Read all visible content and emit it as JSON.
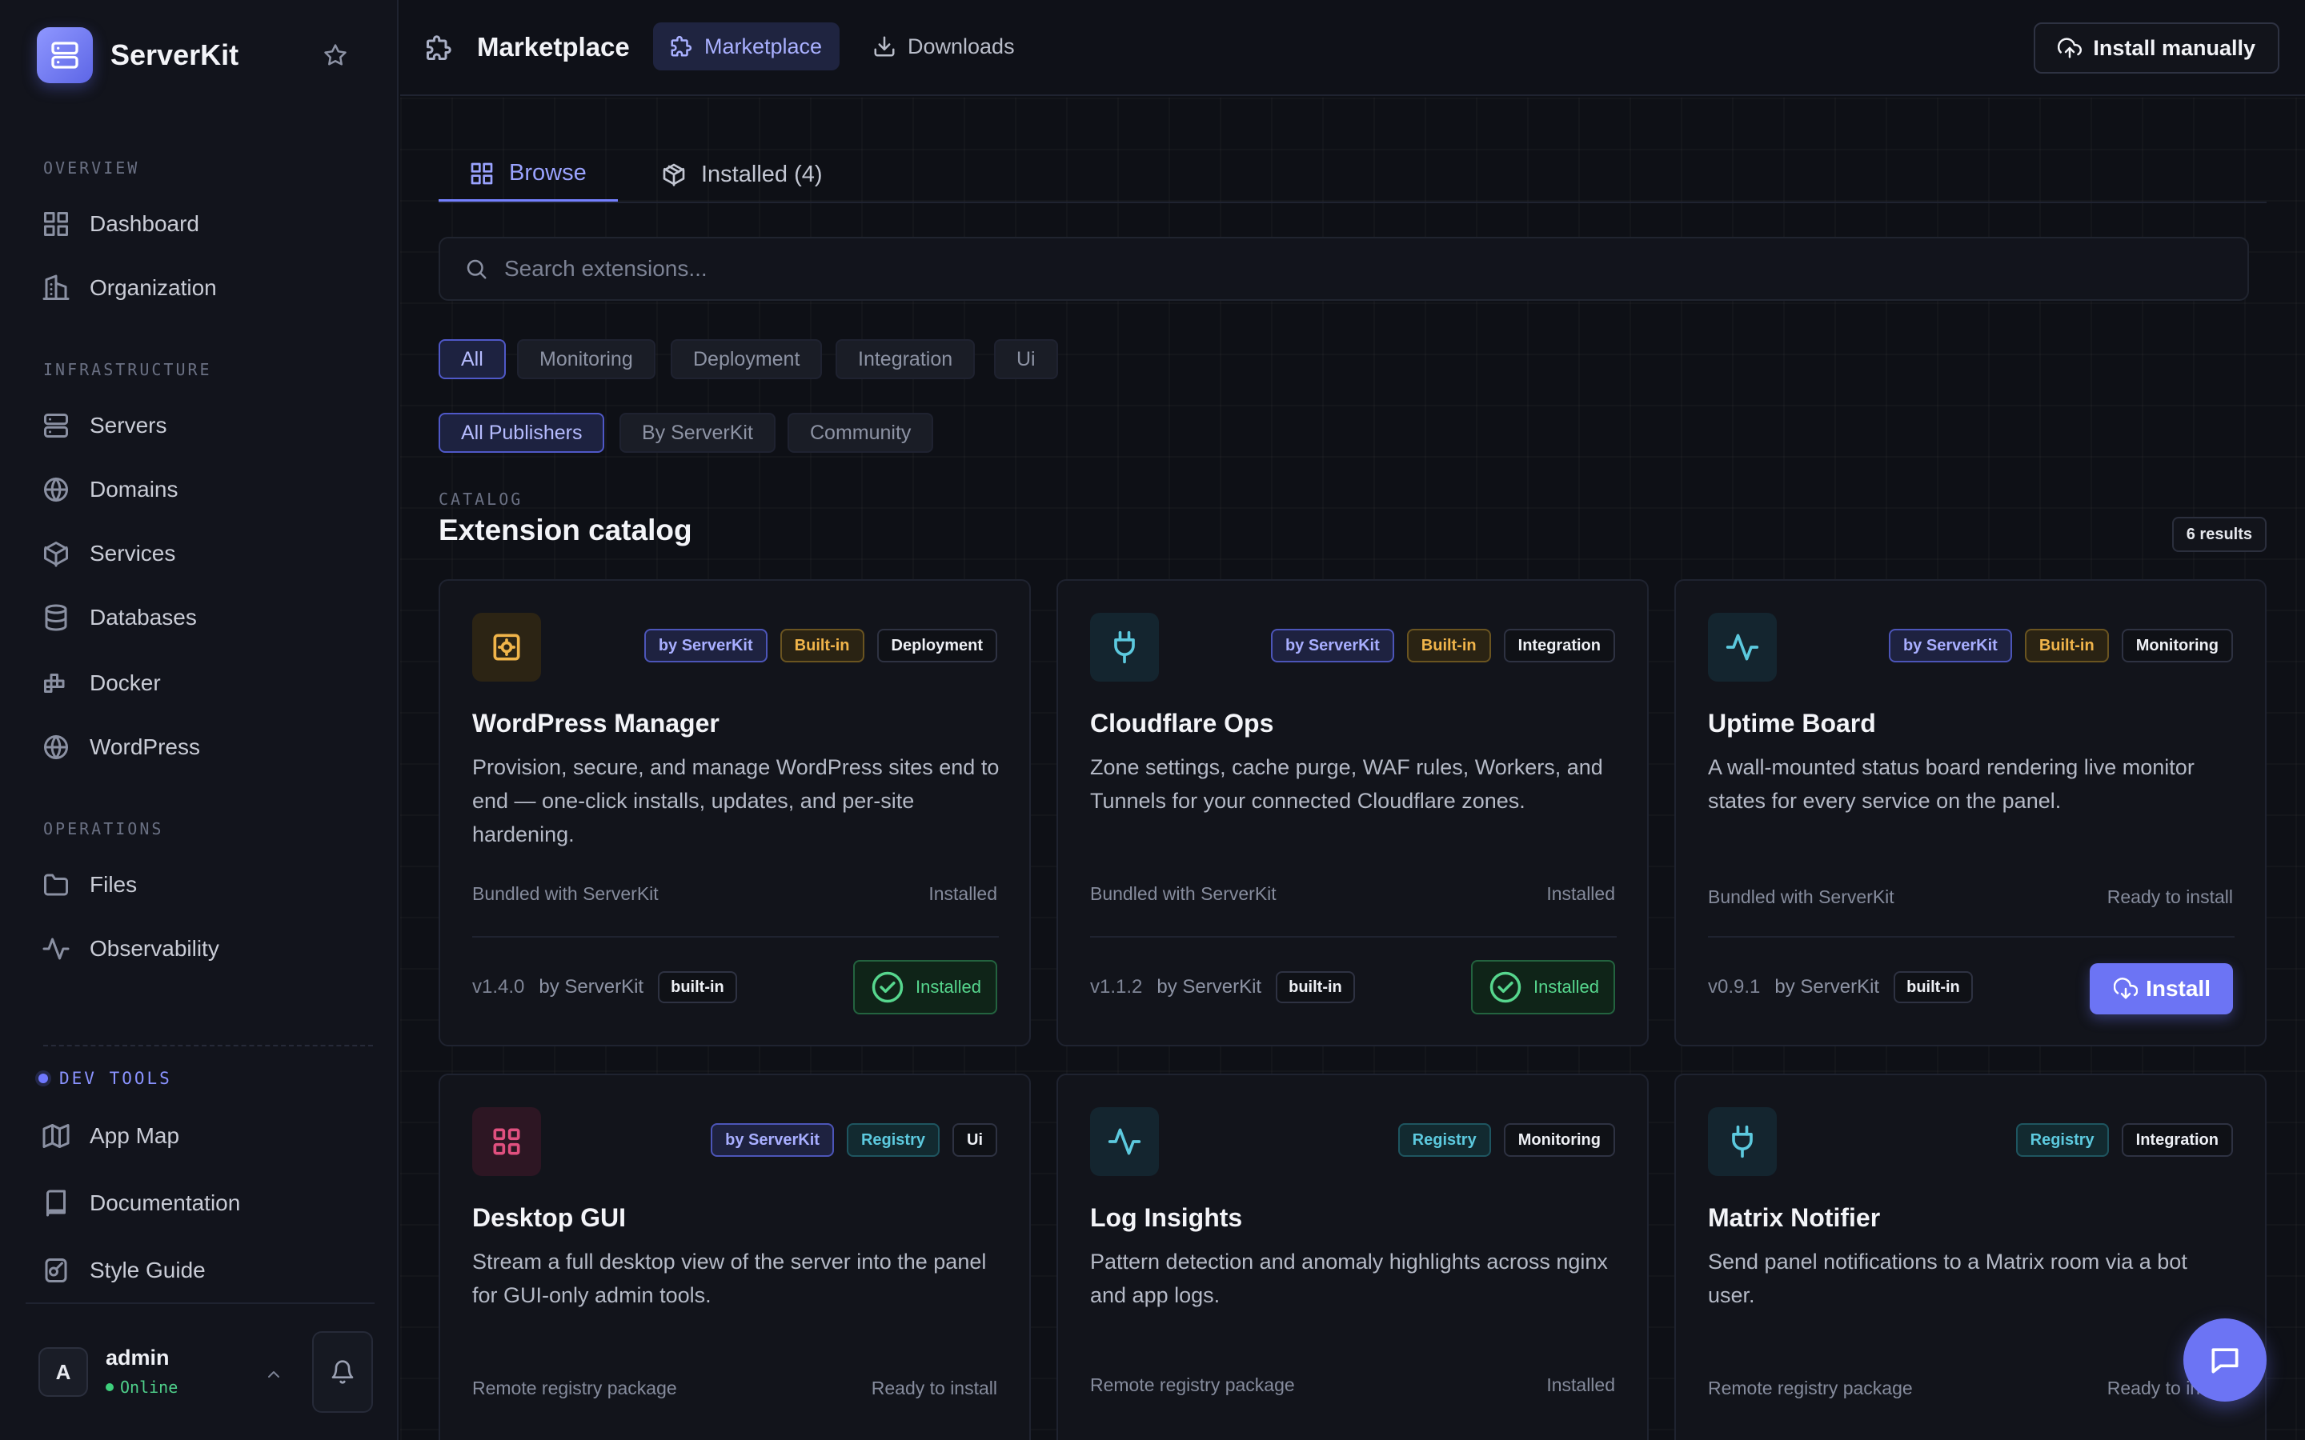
{
  "sidebar": {
    "brand": "ServerKit",
    "sections": {
      "overview": "OVERVIEW",
      "infrastructure": "INFRASTRUCTURE",
      "operations": "OPERATIONS",
      "devtools": "DEV TOOLS"
    },
    "items": {
      "dashboard": "Dashboard",
      "organization": "Organization",
      "servers": "Servers",
      "domains": "Domains",
      "services": "Services",
      "databases": "Databases",
      "docker": "Docker",
      "wordpress": "WordPress",
      "files": "Files",
      "observability": "Observability",
      "appmap": "App Map",
      "documentation": "Documentation",
      "styleguide": "Style Guide"
    },
    "user": {
      "initial": "A",
      "name": "admin",
      "status": "Online"
    }
  },
  "topbar": {
    "title": "Marketplace",
    "tab_marketplace": "Marketplace",
    "tab_downloads": "Downloads",
    "install_manually": "Install manually"
  },
  "content": {
    "tab_browse": "Browse",
    "tab_installed": "Installed (4)",
    "search_placeholder": "Search extensions...",
    "categories": [
      "All",
      "Monitoring",
      "Deployment",
      "Integration",
      "Ui"
    ],
    "publishers": [
      "All Publishers",
      "By ServerKit",
      "Community"
    ],
    "section_label": "CATALOG",
    "section_title": "Extension catalog",
    "results": "6 results"
  },
  "cards": [
    {
      "name": "WordPress Manager",
      "desc": "Provision, secure, and manage WordPress sites end to end — one-click installs, updates, and per-site hardening.",
      "tags": [
        "by ServerKit",
        "Built-in",
        "Deployment"
      ],
      "source": "Bundled with ServerKit",
      "state": "Installed",
      "version": "v1.4.0",
      "by": "by ServerKit",
      "badge": "built-in",
      "action": "Installed"
    },
    {
      "name": "Cloudflare Ops",
      "desc": "Zone settings, cache purge, WAF rules, Workers, and Tunnels for your connected Cloudflare zones.",
      "tags": [
        "by ServerKit",
        "Built-in",
        "Integration"
      ],
      "source": "Bundled with ServerKit",
      "state": "Installed",
      "version": "v1.1.2",
      "by": "by ServerKit",
      "badge": "built-in",
      "action": "Installed"
    },
    {
      "name": "Uptime Board",
      "desc": "A wall-mounted status board rendering live monitor states for every service on the panel.",
      "tags": [
        "by ServerKit",
        "Built-in",
        "Monitoring"
      ],
      "source": "Bundled with ServerKit",
      "state": "Ready to install",
      "version": "v0.9.1",
      "by": "by ServerKit",
      "badge": "built-in",
      "action": "Install"
    },
    {
      "name": "Desktop GUI",
      "desc": "Stream a full desktop view of the server into the panel for GUI-only admin tools.",
      "tags": [
        "by ServerKit",
        "Registry",
        "Ui"
      ],
      "source": "Remote registry package",
      "state": "Ready to install"
    },
    {
      "name": "Log Insights",
      "desc": "Pattern detection and anomaly highlights across nginx and app logs.",
      "tags": [
        "Registry",
        "Monitoring"
      ],
      "source": "Remote registry package",
      "state": "Installed"
    },
    {
      "name": "Matrix Notifier",
      "desc": "Send panel notifications to a Matrix room via a bot user.",
      "tags": [
        "Registry",
        "Integration"
      ],
      "source": "Remote registry package",
      "state": "Ready to install"
    }
  ],
  "colors": {
    "accent": "#6c74f4",
    "success": "#56d68d",
    "warning": "#f0b44a",
    "info": "#5cc9de",
    "pink": "#e0507f"
  }
}
